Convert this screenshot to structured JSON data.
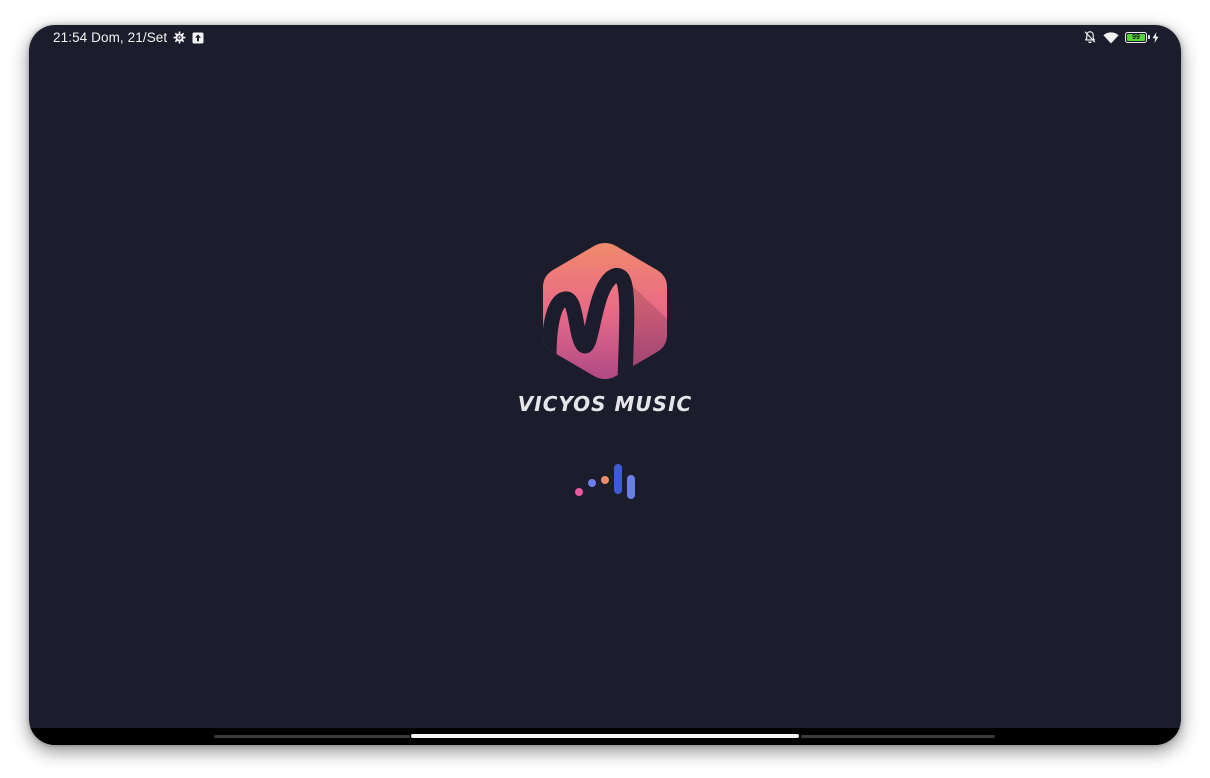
{
  "status_bar": {
    "time_date": "21:54 Dom, 21/Set",
    "left_icons": [
      "settings-gear-icon",
      "upload-notification-icon"
    ],
    "right_icons": [
      "bell-off-icon",
      "wifi-icon",
      "battery-icon",
      "charging-bolt-icon"
    ],
    "battery_level": "99",
    "battery_color": "#58d23b"
  },
  "splash": {
    "app_name": "VICYOS MUSIC",
    "logo_letter": "M",
    "logo_gradient": [
      "#f08a6c",
      "#e96a87",
      "#b04a86"
    ],
    "background": "#1b1c2c"
  },
  "loader": {
    "icon": "loading-equalizer-icon",
    "colors": [
      "#e85aa0",
      "#6d7ee8",
      "#f08a6c",
      "#3e5bd6",
      "#6a7fe6"
    ]
  },
  "navigation": {
    "gesture_handle": "home-gesture-bar"
  }
}
